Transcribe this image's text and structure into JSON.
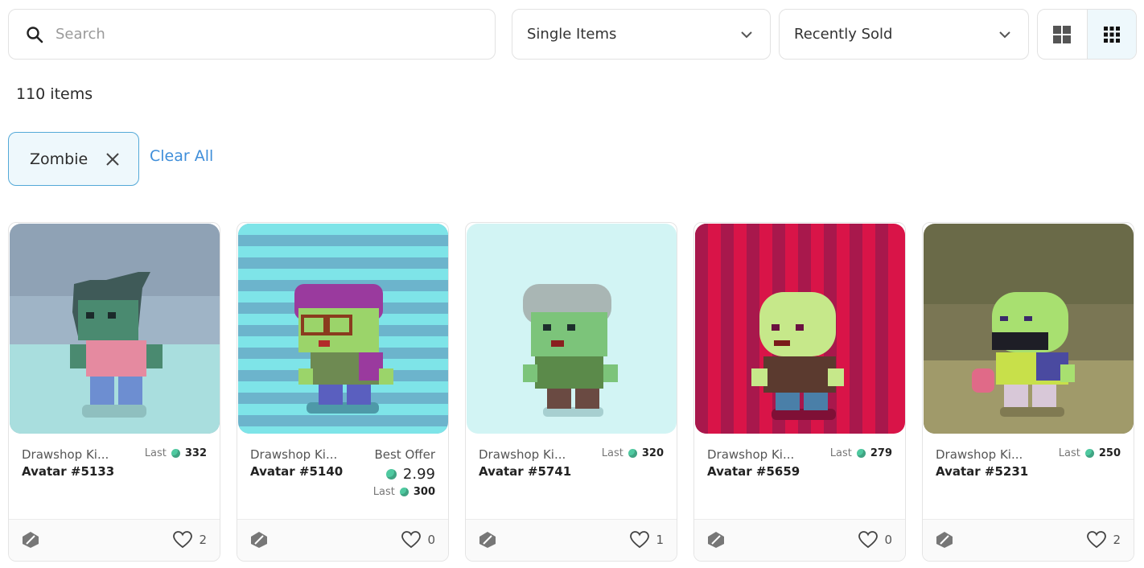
{
  "search": {
    "placeholder": "Search"
  },
  "filters": {
    "type_selected": "Single Items",
    "sort_selected": "Recently Sold"
  },
  "results": {
    "count_text": "110 items"
  },
  "active_filters": {
    "chip_label": "Zombie",
    "clear_label": "Clear All"
  },
  "colors": {
    "accent": "#3f8ed9",
    "chip_border": "#54a9d8",
    "gem": "#4fc9a0"
  },
  "cards": [
    {
      "collection": "Drawshop Ki...",
      "name": "Avatar #5133",
      "last_label": "Last",
      "last_value": "332",
      "likes": "2"
    },
    {
      "collection": "Drawshop Ki...",
      "name": "Avatar #5140",
      "best_offer_label": "Best Offer",
      "best_offer_value": "2.99",
      "last_label": "Last",
      "last_value": "300",
      "likes": "0"
    },
    {
      "collection": "Drawshop Ki...",
      "name": "Avatar #5741",
      "last_label": "Last",
      "last_value": "320",
      "likes": "1"
    },
    {
      "collection": "Drawshop Ki...",
      "name": "Avatar #5659",
      "last_label": "Last",
      "last_value": "279",
      "likes": "0"
    },
    {
      "collection": "Drawshop Ki...",
      "name": "Avatar #5231",
      "last_label": "Last",
      "last_value": "250",
      "likes": "2"
    }
  ]
}
